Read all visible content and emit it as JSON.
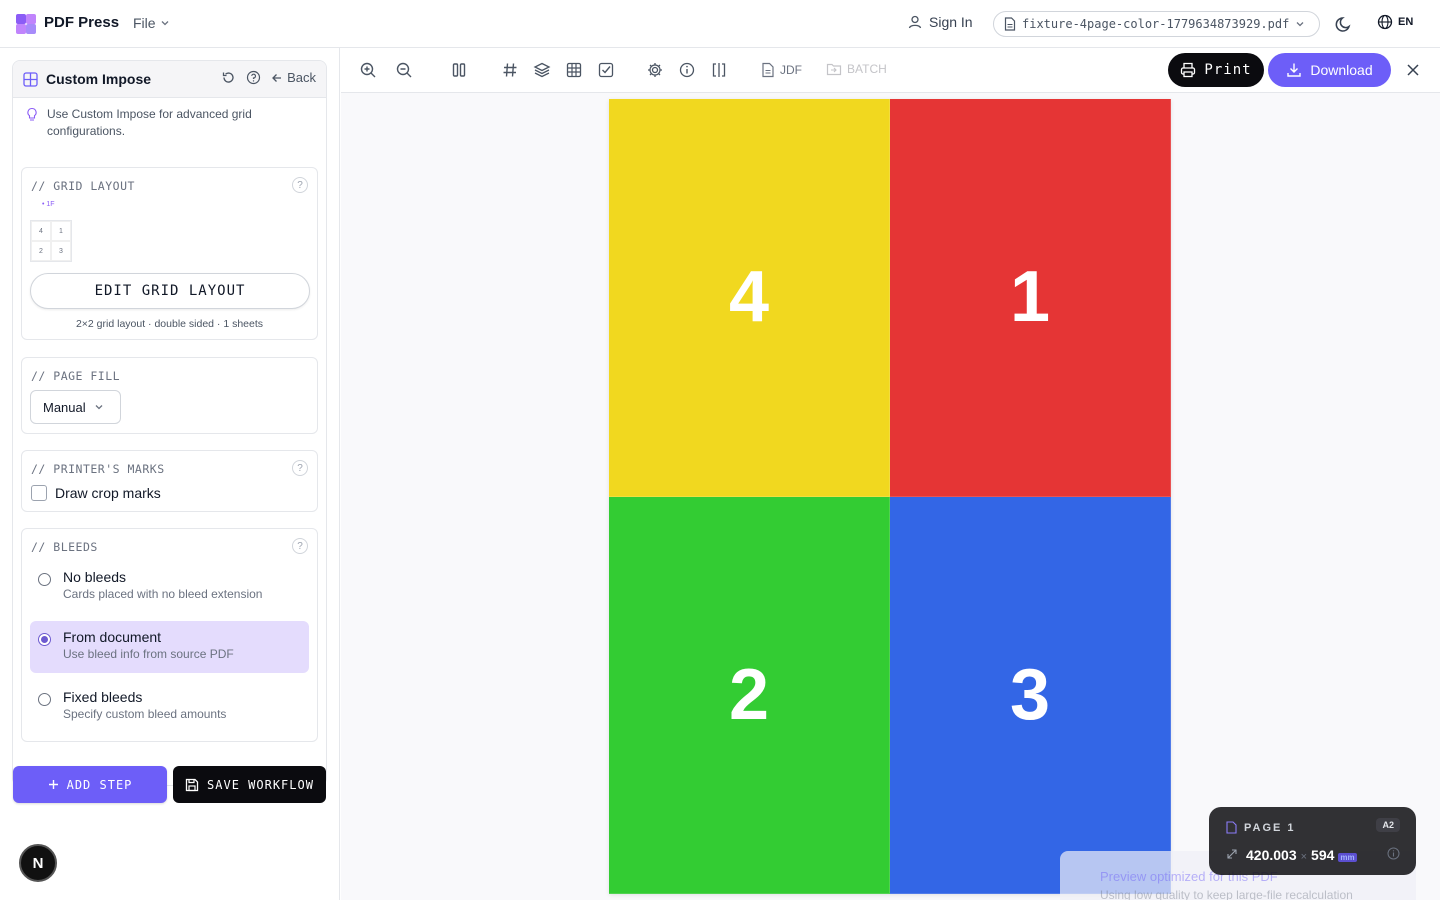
{
  "header": {
    "brand": "PDF Press",
    "file_menu": "File",
    "sign_in": "Sign In",
    "file_name": "fixture-4page-color-1779634873929.pdf",
    "language": "EN"
  },
  "sidebar": {
    "panel_title": "Custom Impose",
    "back_label": "Back",
    "hint": "Use Custom Impose for advanced grid configurations.",
    "grid_layout": {
      "title": "// GRID LAYOUT",
      "mini_label": "1F",
      "cells": [
        "4",
        "1",
        "2",
        "3"
      ],
      "edit_button": "EDIT GRID LAYOUT",
      "summary": "2×2 grid layout · double sided · 1 sheets"
    },
    "page_fill": {
      "title": "// PAGE FILL",
      "selected": "Manual"
    },
    "printers_marks": {
      "title": "// PRINTER'S MARKS",
      "crop_marks_label": "Draw crop marks",
      "crop_marks_checked": false
    },
    "bleeds": {
      "title": "// BLEEDS",
      "options": [
        {
          "label": "No bleeds",
          "desc": "Cards placed with no bleed extension",
          "selected": false
        },
        {
          "label": "From document",
          "desc": "Use bleed info from source PDF",
          "selected": true
        },
        {
          "label": "Fixed bleeds",
          "desc": "Specify custom bleed amounts",
          "selected": false
        }
      ]
    },
    "add_step": "ADD STEP",
    "save_workflow": "SAVE WORKFLOW",
    "badge": "N"
  },
  "toolbar": {
    "jdf": "JDF",
    "batch": "BATCH",
    "print": "Print",
    "download": "Download"
  },
  "preview": {
    "cells": [
      {
        "label": "4",
        "color": "#f1d81f"
      },
      {
        "label": "1",
        "color": "#e53535"
      },
      {
        "label": "2",
        "color": "#33cc33"
      },
      {
        "label": "3",
        "color": "#3366e6"
      }
    ]
  },
  "toast": {
    "title": "Preview optimized for this PDF",
    "desc": "Using low quality to keep large-file recalculation"
  },
  "page_info": {
    "label": "PAGE 1",
    "size_badge": "A2",
    "width": "420.003",
    "separator": "×",
    "height": "594",
    "unit": "mm"
  },
  "colors": {
    "accent": "#6d5ef8",
    "selected_bg": "#e4dcfd",
    "dark": "#0b0b0f"
  }
}
